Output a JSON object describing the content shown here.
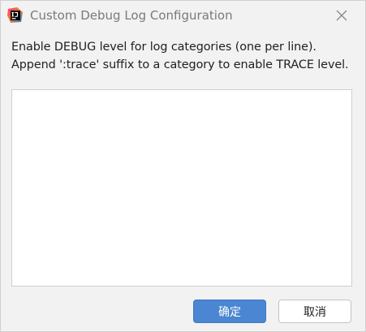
{
  "window": {
    "title": "Custom Debug Log Configuration",
    "app_icon": "intellij-idea-icon",
    "close_icon": "close-icon"
  },
  "description": {
    "line1": "Enable DEBUG level for log categories (one per line).",
    "line2": "Append ':trace' suffix to a category to enable TRACE level."
  },
  "editor": {
    "value": ""
  },
  "buttons": {
    "ok_label": "确定",
    "cancel_label": "取消"
  },
  "colors": {
    "primary_button": "#4a86d1",
    "background": "#f2f2f2"
  }
}
